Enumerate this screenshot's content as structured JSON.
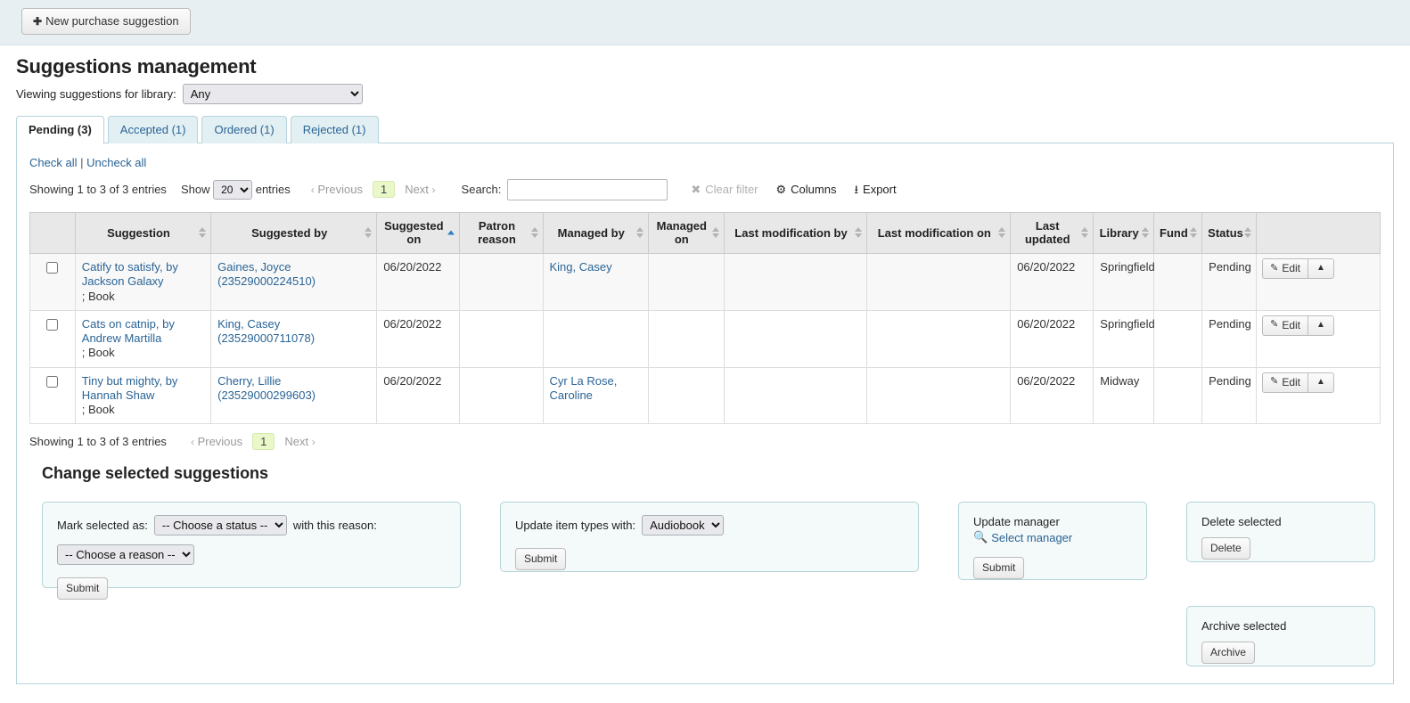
{
  "toolbar": {
    "new_suggestion_label": "New purchase suggestion",
    "plus_icon": "plus-icon"
  },
  "header": {
    "page_title": "Suggestions management",
    "library_label": "Viewing suggestions for library:",
    "library_selected": "Any",
    "library_options": [
      "Any"
    ]
  },
  "tabs": [
    {
      "label": "Pending (3)",
      "active": true
    },
    {
      "label": "Accepted (1)",
      "active": false
    },
    {
      "label": "Ordered (1)",
      "active": false
    },
    {
      "label": "Rejected (1)",
      "active": false
    }
  ],
  "check_links": {
    "check_all": "Check all",
    "separator": "|",
    "uncheck_all": "Uncheck all"
  },
  "datatable_controls": {
    "info": "Showing 1 to 3 of 3 entries",
    "show_label": "Show",
    "entries_label": "entries",
    "page_length": "20",
    "page_length_options": [
      "20"
    ],
    "previous_label": "Previous",
    "next_label": "Next",
    "current_page": "1",
    "search_label": "Search:",
    "search_value": "",
    "clear_filter_label": "Clear filter",
    "clear_filter_disabled": true,
    "columns_label": "Columns",
    "export_label": "Export"
  },
  "table": {
    "columns": [
      {
        "label": "",
        "sortable": false,
        "key": "checkbox"
      },
      {
        "label": "Suggestion",
        "sortable": true,
        "sorted": "none"
      },
      {
        "label": "Suggested by",
        "sortable": true,
        "sorted": "none"
      },
      {
        "label": "Suggested on",
        "sortable": true,
        "sorted": "asc"
      },
      {
        "label": "Patron reason",
        "sortable": true,
        "sorted": "none"
      },
      {
        "label": "Managed by",
        "sortable": true,
        "sorted": "none"
      },
      {
        "label": "Managed on",
        "sortable": true,
        "sorted": "none"
      },
      {
        "label": "Last modification by",
        "sortable": true,
        "sorted": "none"
      },
      {
        "label": "Last modification on",
        "sortable": true,
        "sorted": "none"
      },
      {
        "label": "Last updated",
        "sortable": true,
        "sorted": "none"
      },
      {
        "label": "Library",
        "sortable": true,
        "sorted": "none"
      },
      {
        "label": "Fund",
        "sortable": true,
        "sorted": "none"
      },
      {
        "label": "Status",
        "sortable": true,
        "sorted": "none"
      },
      {
        "label": "",
        "sortable": false,
        "key": "actions"
      }
    ],
    "rows": [
      {
        "checked": false,
        "suggestion_title": "Catify to satisfy, by Jackson Galaxy",
        "suggestion_sub": "; Book",
        "suggested_by": "Gaines, Joyce (23529000224510)",
        "suggested_on": "06/20/2022",
        "patron_reason": "",
        "managed_by": "King, Casey",
        "managed_on": "",
        "last_modification_by": "",
        "last_modification_on": "",
        "last_updated": "06/20/2022",
        "library": "Springfield",
        "fund": "",
        "status": "Pending",
        "edit_label": "Edit"
      },
      {
        "checked": false,
        "suggestion_title": "Cats on catnip, by Andrew Martilla",
        "suggestion_sub": "; Book",
        "suggested_by": "King, Casey (23529000711078)",
        "suggested_on": "06/20/2022",
        "patron_reason": "",
        "managed_by": "",
        "managed_on": "",
        "last_modification_by": "",
        "last_modification_on": "",
        "last_updated": "06/20/2022",
        "library": "Springfield",
        "fund": "",
        "status": "Pending",
        "edit_label": "Edit"
      },
      {
        "checked": false,
        "suggestion_title": "Tiny but mighty, by Hannah Shaw",
        "suggestion_sub": "; Book",
        "suggested_by": "Cherry, Lillie (23529000299603)",
        "suggested_on": "06/20/2022",
        "patron_reason": "",
        "managed_by": "Cyr La Rose, Caroline",
        "managed_on": "",
        "last_modification_by": "",
        "last_modification_on": "",
        "last_updated": "06/20/2022",
        "library": "Midway",
        "fund": "",
        "status": "Pending",
        "edit_label": "Edit"
      }
    ]
  },
  "change_selected": {
    "heading": "Change selected suggestions",
    "mark": {
      "label_before": "Mark selected as:",
      "status_selected": "-- Choose a status --",
      "status_options": [
        "-- Choose a status --"
      ],
      "label_after": "with this reason:",
      "reason_selected": "-- Choose a reason --",
      "reason_options": [
        "-- Choose a reason --"
      ],
      "submit_label": "Submit"
    },
    "item_types": {
      "label": "Update item types with:",
      "selected": "Audiobook",
      "options": [
        "Audiobook"
      ],
      "submit_label": "Submit"
    },
    "manager": {
      "title": "Update manager",
      "select_link": "Select manager",
      "search_icon": "search-icon",
      "submit_label": "Submit"
    },
    "delete": {
      "title": "Delete selected",
      "button_label": "Delete"
    },
    "archive": {
      "title": "Archive selected",
      "button_label": "Archive"
    }
  },
  "colors": {
    "toolbar_bg": "#e8eff3",
    "link": "#2a6496",
    "panel_border": "#b4d5d8",
    "panel_bg": "#f4f9f9",
    "sort_active": "#2b7dc0",
    "page_current_bg": "#eaf7c8"
  }
}
